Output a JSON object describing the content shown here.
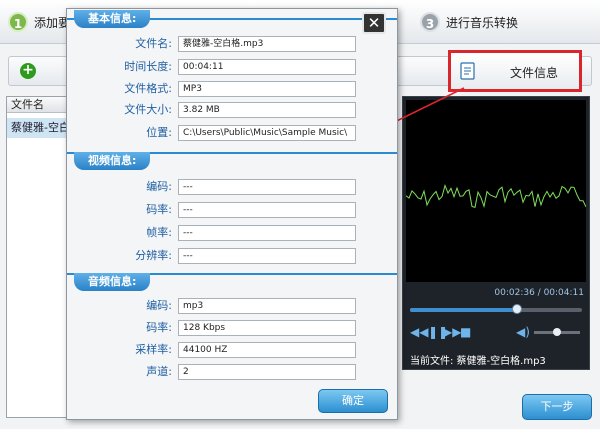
{
  "steps": {
    "step1": {
      "number": "1",
      "label": "添加要"
    },
    "step3": {
      "number": "3",
      "label": "进行音乐转换"
    }
  },
  "toolbar": {
    "add_label": "+",
    "file_info_label": "文件信息"
  },
  "file_list": {
    "header": "文件名",
    "rows": [
      {
        "name": "蔡健雅-空白格"
      }
    ]
  },
  "player": {
    "time": "00:02:36 / 00:04:11",
    "progress": 0.62,
    "volume": 0.5,
    "current_file": "当前文件: 蔡健雅-空白格.mp3"
  },
  "next_button": "下一步",
  "dialog": {
    "close_label": "✕",
    "basic": {
      "title": "基本信息:",
      "fields": [
        {
          "label": "文件名:",
          "value": "蔡健雅-空白格.mp3"
        },
        {
          "label": "时间长度:",
          "value": "00:04:11"
        },
        {
          "label": "文件格式:",
          "value": "MP3"
        },
        {
          "label": "文件大小:",
          "value": "3.82 MB"
        },
        {
          "label": "位置:",
          "value": "C:\\Users\\Public\\Music\\Sample Music\\"
        }
      ]
    },
    "video": {
      "title": "视频信息:",
      "fields": [
        {
          "label": "编码:",
          "value": "---"
        },
        {
          "label": "码率:",
          "value": "---"
        },
        {
          "label": "帧率:",
          "value": "---"
        },
        {
          "label": "分辨率:",
          "value": "---"
        }
      ]
    },
    "audio": {
      "title": "音频信息:",
      "fields": [
        {
          "label": "编码:",
          "value": "mp3"
        },
        {
          "label": "码率:",
          "value": "128 Kbps"
        },
        {
          "label": "采样率:",
          "value": "44100 HZ"
        },
        {
          "label": "声道:",
          "value": "2"
        }
      ]
    },
    "ok_label": "确定"
  },
  "colors": {
    "accent": "#2b8ad0",
    "highlight": "#d9262c",
    "waveform": "#7fe05a"
  }
}
